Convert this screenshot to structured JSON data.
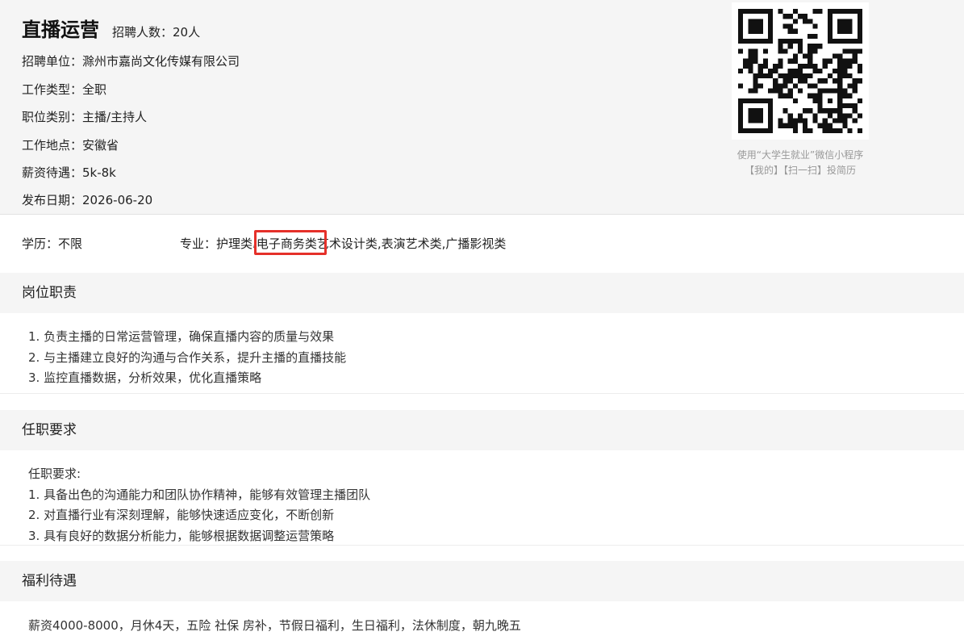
{
  "job": {
    "title": "直播运营",
    "headcount": "招聘人数：20人",
    "company": "招聘单位：滁州市嘉尚文化传媒有限公司",
    "work_type": "工作类型：全职",
    "category": "职位类别：主播/主持人",
    "location": "工作地点：安徽省",
    "salary": "薪资待遇：5k-8k",
    "publish_date": "发布日期：2026-06-20"
  },
  "qr": {
    "caption_line1": "使用“大学生就业”微信小程序",
    "caption_line2": "【我的】【扫一扫】投简历"
  },
  "requirements": {
    "education": "学历：不限",
    "major_label": "专业：",
    "majors": [
      "护理类",
      ",",
      "电子商务类",
      "艺术设计类,表演艺术类,广播影视类"
    ]
  },
  "duties": {
    "heading": "岗位职责",
    "items": [
      "1. 负责主播的日常运营管理，确保直播内容的质量与效果",
      "2. 与主播建立良好的沟通与合作关系，提升主播的直播技能",
      "3. 监控直播数据，分析效果，优化直播策略"
    ]
  },
  "qualifications": {
    "heading": "任职要求",
    "intro": "任职要求:",
    "items": [
      "1. 具备出色的沟通能力和团队协作精神，能够有效管理主播团队",
      "2. 对直播行业有深刻理解，能够快速适应变化，不断创新",
      "3. 具有良好的数据分析能力，能够根据数据调整运营策略"
    ]
  },
  "benefits": {
    "heading": "福利待遇",
    "text": "薪资4000-8000，月休4天，五险 社保 房补，节假日福利，生日福利，法休制度，朝九晚五"
  },
  "colors": {
    "highlight": "#e5302a",
    "header_bg": "#f5f5f5"
  }
}
